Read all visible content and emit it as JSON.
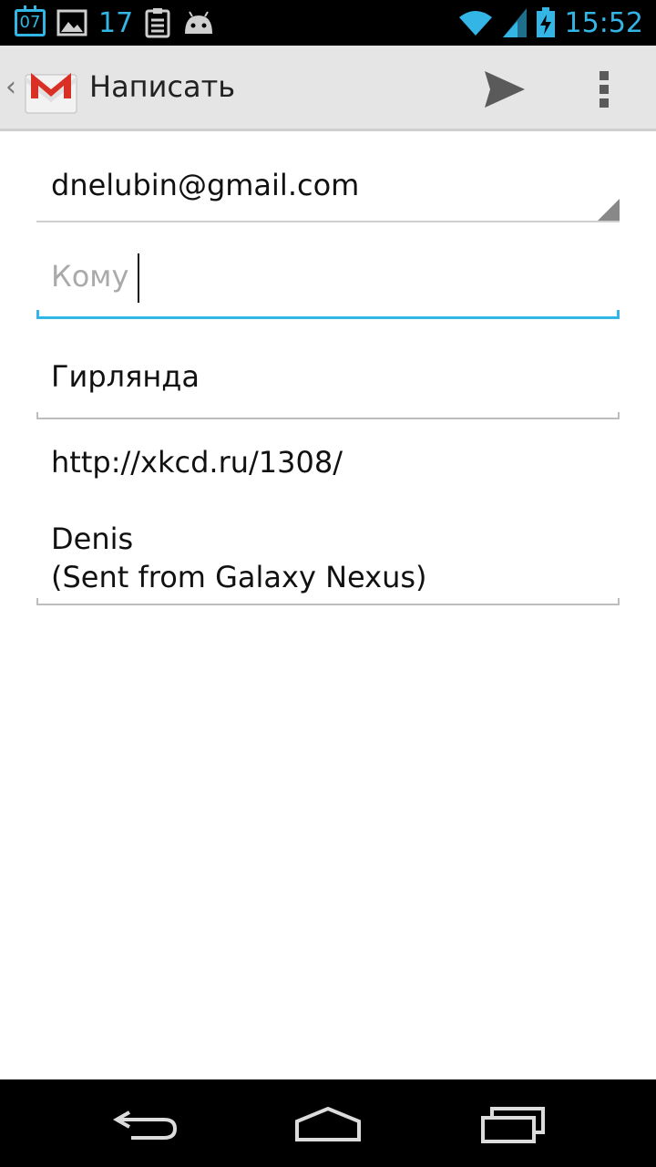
{
  "status_bar": {
    "calendar_date": "07",
    "notification_count": "17",
    "time": "15:52",
    "icons": [
      "calendar-icon",
      "gallery-icon",
      "clipboard-icon",
      "android-icon",
      "wifi-icon",
      "signal-icon",
      "battery-charging-icon"
    ]
  },
  "action_bar": {
    "back_glyph": "‹",
    "title": "Написать",
    "icons": [
      "gmail-icon",
      "send-icon",
      "overflow-menu-icon"
    ]
  },
  "compose": {
    "from_account": "dnelubin@gmail.com",
    "to_placeholder": "Кому",
    "to_value": "",
    "subject": "Гирлянда",
    "body_line1": "http://xkcd.ru/1308/",
    "body_line2": "Denis",
    "body_line3": "(Sent from Galaxy Nexus)"
  },
  "nav_bar": {
    "icons": [
      "back-icon",
      "home-icon",
      "recent-apps-icon"
    ]
  },
  "colors": {
    "accent": "#33b5e5",
    "gmail_red": "#d93025",
    "action_bar_bg": "#e5e5e5"
  }
}
